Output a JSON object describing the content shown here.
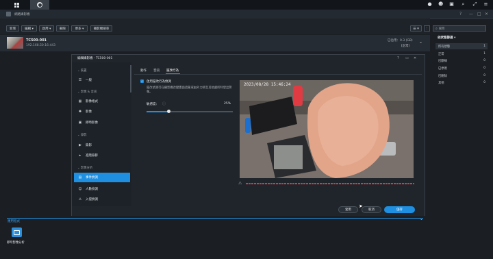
{
  "app": {
    "title": "網路攝影機"
  },
  "toolbar": {
    "new": "新增",
    "edit": "編輯 ▾",
    "enable": "啟用 ▾",
    "delete": "刪除",
    "more": "更多 ▾",
    "finder": "攝影機搜尋"
  },
  "search": {
    "placeholder": "搜尋"
  },
  "camera": {
    "name": "TC500-001",
    "ip": "192.168.50.16:443",
    "storage": "已佔用：0.3 (GB)",
    "status": "[正常]"
  },
  "filter": {
    "title": "依狀態篩選 ▾",
    "items": [
      {
        "label": "所有狀態",
        "count": "1"
      },
      {
        "label": "正常",
        "count": "1"
      },
      {
        "label": "已斷線",
        "count": "0"
      },
      {
        "label": "已停用",
        "count": "0"
      },
      {
        "label": "已刪除",
        "count": "0"
      },
      {
        "label": "其他",
        "count": "0"
      }
    ]
  },
  "dialog": {
    "title": "編輯攝影機 - TC500-001",
    "sidebar": {
      "sec_device": "裝置",
      "general": "一般",
      "sec_av": "影像 & 音訊",
      "video_format": "影像格式",
      "image": "影像",
      "live_image": "即時影像",
      "sec_record": "錄影",
      "recording": "錄影",
      "advanced_rec": "進階錄影",
      "sec_analytics": "影像分析",
      "event_detect": "事件偵測",
      "people_detect": "人數偵測",
      "intrusion_detect": "入侵偵測"
    },
    "tabs": [
      "動作",
      "音訊",
      "竄改行為"
    ],
    "enable_label": "啟用竄改行為偵測",
    "desc": "竄改偵測可在攝影機改變畫面遮蔽或由外力移至其他處所時發出警報。",
    "sensitivity_label": "敏感度：",
    "sensitivity_value": "25%",
    "sensitivity_level": 0.25,
    "timestamp": "2023/08/28 15:46:24",
    "buttons": {
      "apply": "套用",
      "cancel": "取消",
      "save": "儲存"
    }
  },
  "bottom": {
    "section": "應用程式",
    "app_label": "即時影像分析"
  }
}
